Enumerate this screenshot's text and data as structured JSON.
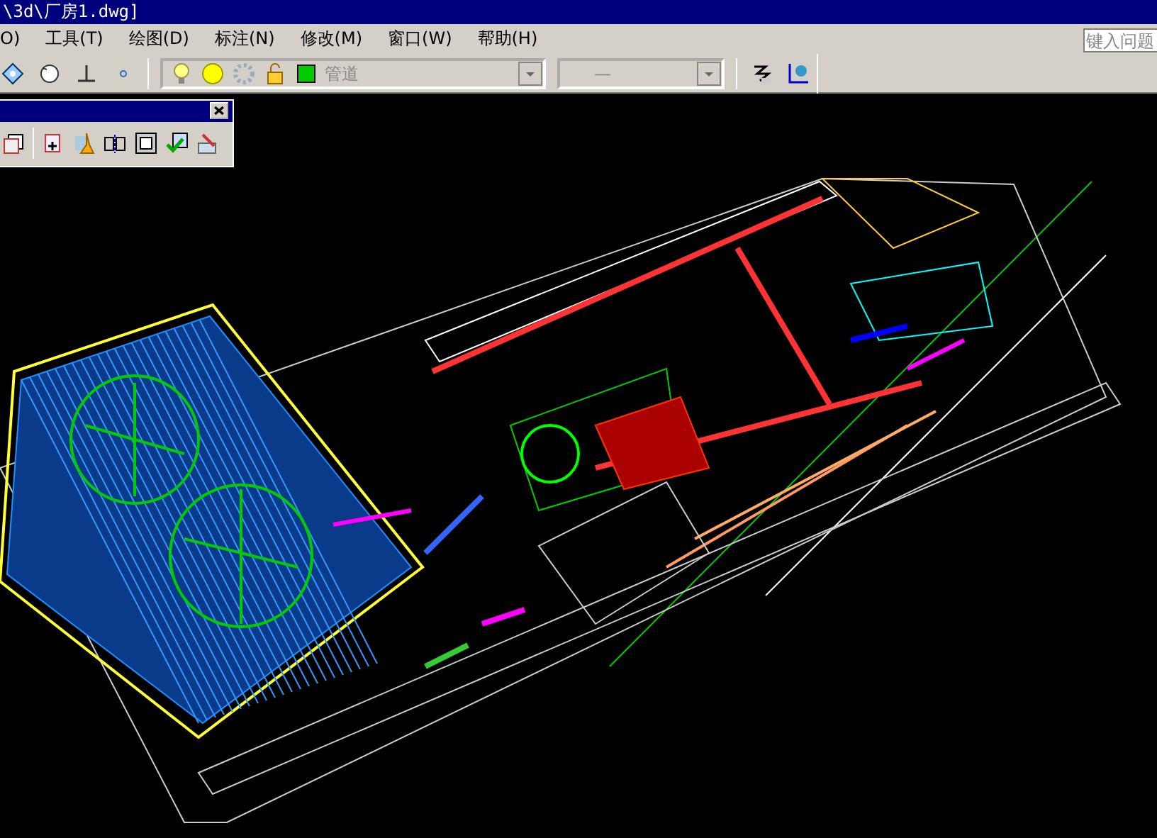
{
  "window": {
    "title": "\\3d\\厂房1.dwg]"
  },
  "menu": [
    {
      "label": "O)"
    },
    {
      "label": "工具(T)"
    },
    {
      "label": "绘图(D)"
    },
    {
      "label": "标注(N)"
    },
    {
      "label": "修改(M)"
    },
    {
      "label": "窗口(W)"
    },
    {
      "label": "帮助(H)"
    }
  ],
  "help_field": {
    "placeholder": "键入问题"
  },
  "layer_dropdown": {
    "value": "管道"
  },
  "linetype_dropdown": {
    "value": "—"
  }
}
